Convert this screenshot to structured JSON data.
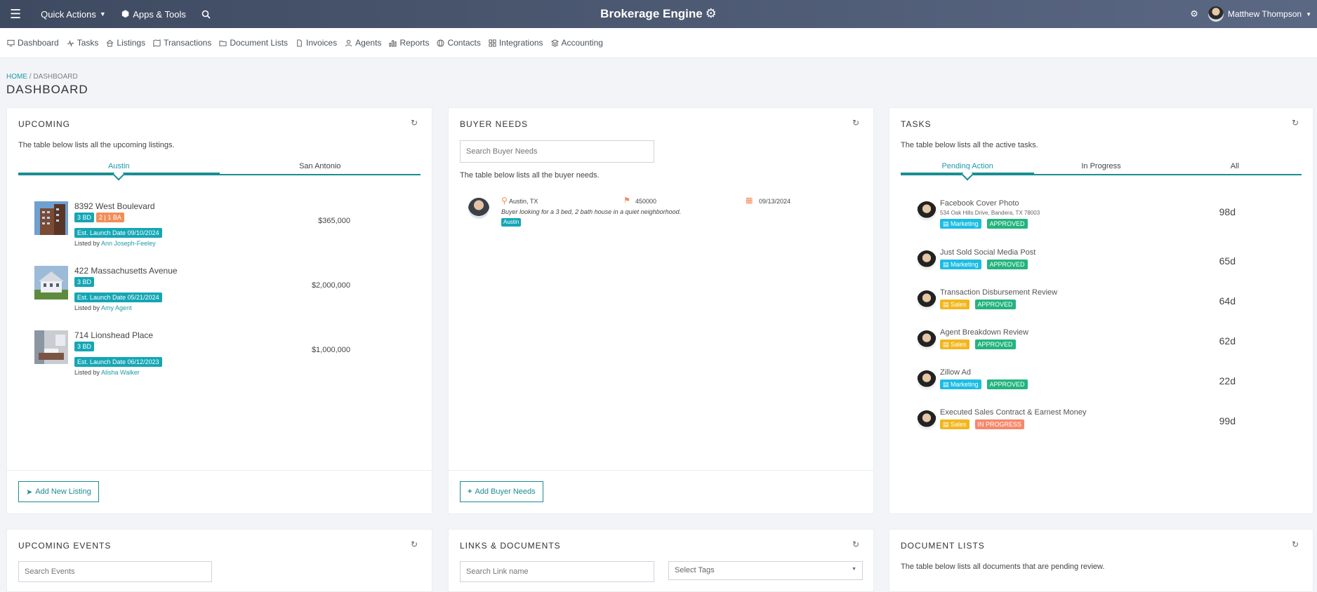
{
  "topbar": {
    "quick_actions": "Quick Actions",
    "apps_tools": "Apps & Tools",
    "brand": "Brokerage Engine",
    "user": "Matthew Thompson"
  },
  "nav": [
    "Dashboard",
    "Tasks",
    "Listings",
    "Transactions",
    "Document Lists",
    "Invoices",
    "Agents",
    "Reports",
    "Contacts",
    "Integrations",
    "Accounting"
  ],
  "breadcrumb": {
    "home": "HOME",
    "sep": "/",
    "current": "DASHBOARD"
  },
  "page_title": "DASHBOARD",
  "upcoming": {
    "title": "UPCOMING",
    "desc": "The table below lists all the upcoming listings.",
    "tabs": [
      "Austin",
      "San Antonio"
    ],
    "listings": [
      {
        "address": "8392 West Boulevard",
        "beds": "3 BD",
        "baths": "2 | 1 BA",
        "launch": "Est. Launch Date 09/10/2024",
        "listed_by": "Listed by",
        "agent": "Ann Joseph-Feeley",
        "price": "$365,000"
      },
      {
        "address": "422 Massachusetts Avenue",
        "beds": "3 BD",
        "baths": "",
        "launch": "Est. Launch Date 05/21/2024",
        "listed_by": "Listed by",
        "agent": "Amy Agent",
        "price": "$2,000,000"
      },
      {
        "address": "714 Lionshead Place",
        "beds": "3 BD",
        "baths": "",
        "launch": "Est. Launch Date 06/12/2023",
        "listed_by": "Listed by",
        "agent": "Alisha Walker",
        "price": "$1,000,000"
      }
    ],
    "button": "Add New Listing"
  },
  "buyer_needs": {
    "title": "BUYER NEEDS",
    "search_placeholder": "Search Buyer Needs",
    "desc": "The table below lists all the buyer needs.",
    "need": {
      "location": "Austin, TX",
      "budget": "450000",
      "date": "09/13/2024",
      "note": "Buyer looking for a 3 bed, 2 bath house in a quiet neighborhood.",
      "tag": "Austin"
    },
    "button": "Add Buyer Needs"
  },
  "tasks": {
    "title": "TASKS",
    "desc": "The table below lists all the active tasks.",
    "tabs": [
      "Pending Action",
      "In Progress",
      "All"
    ],
    "items": [
      {
        "title": "Facebook Cover Photo",
        "sub": "534 Oak Hills Drive, Bandera, TX 78003",
        "category": "Marketing",
        "status": "APPROVED",
        "days": "98d"
      },
      {
        "title": "Just Sold Social Media Post",
        "sub": "",
        "category": "Marketing",
        "status": "APPROVED",
        "days": "65d"
      },
      {
        "title": "Transaction Disbursement Review",
        "sub": "",
        "category": "Sales",
        "status": "APPROVED",
        "days": "64d"
      },
      {
        "title": "Agent Breakdown Review",
        "sub": "",
        "category": "Sales",
        "status": "APPROVED",
        "days": "62d"
      },
      {
        "title": "Zillow Ad",
        "sub": "",
        "category": "Marketing",
        "status": "APPROVED",
        "days": "22d"
      },
      {
        "title": "Executed Sales Contract & Earnest Money",
        "sub": "",
        "category": "Sales",
        "status": "IN PROGRESS",
        "days": "99d"
      }
    ]
  },
  "events": {
    "title": "UPCOMING EVENTS",
    "search_placeholder": "Search Events"
  },
  "links": {
    "title": "LINKS & DOCUMENTS",
    "search_placeholder": "Search Link name",
    "tags_placeholder": "Select Tags"
  },
  "doc_lists": {
    "title": "DOCUMENT LISTS",
    "desc": "The table below lists all documents that are pending review."
  }
}
